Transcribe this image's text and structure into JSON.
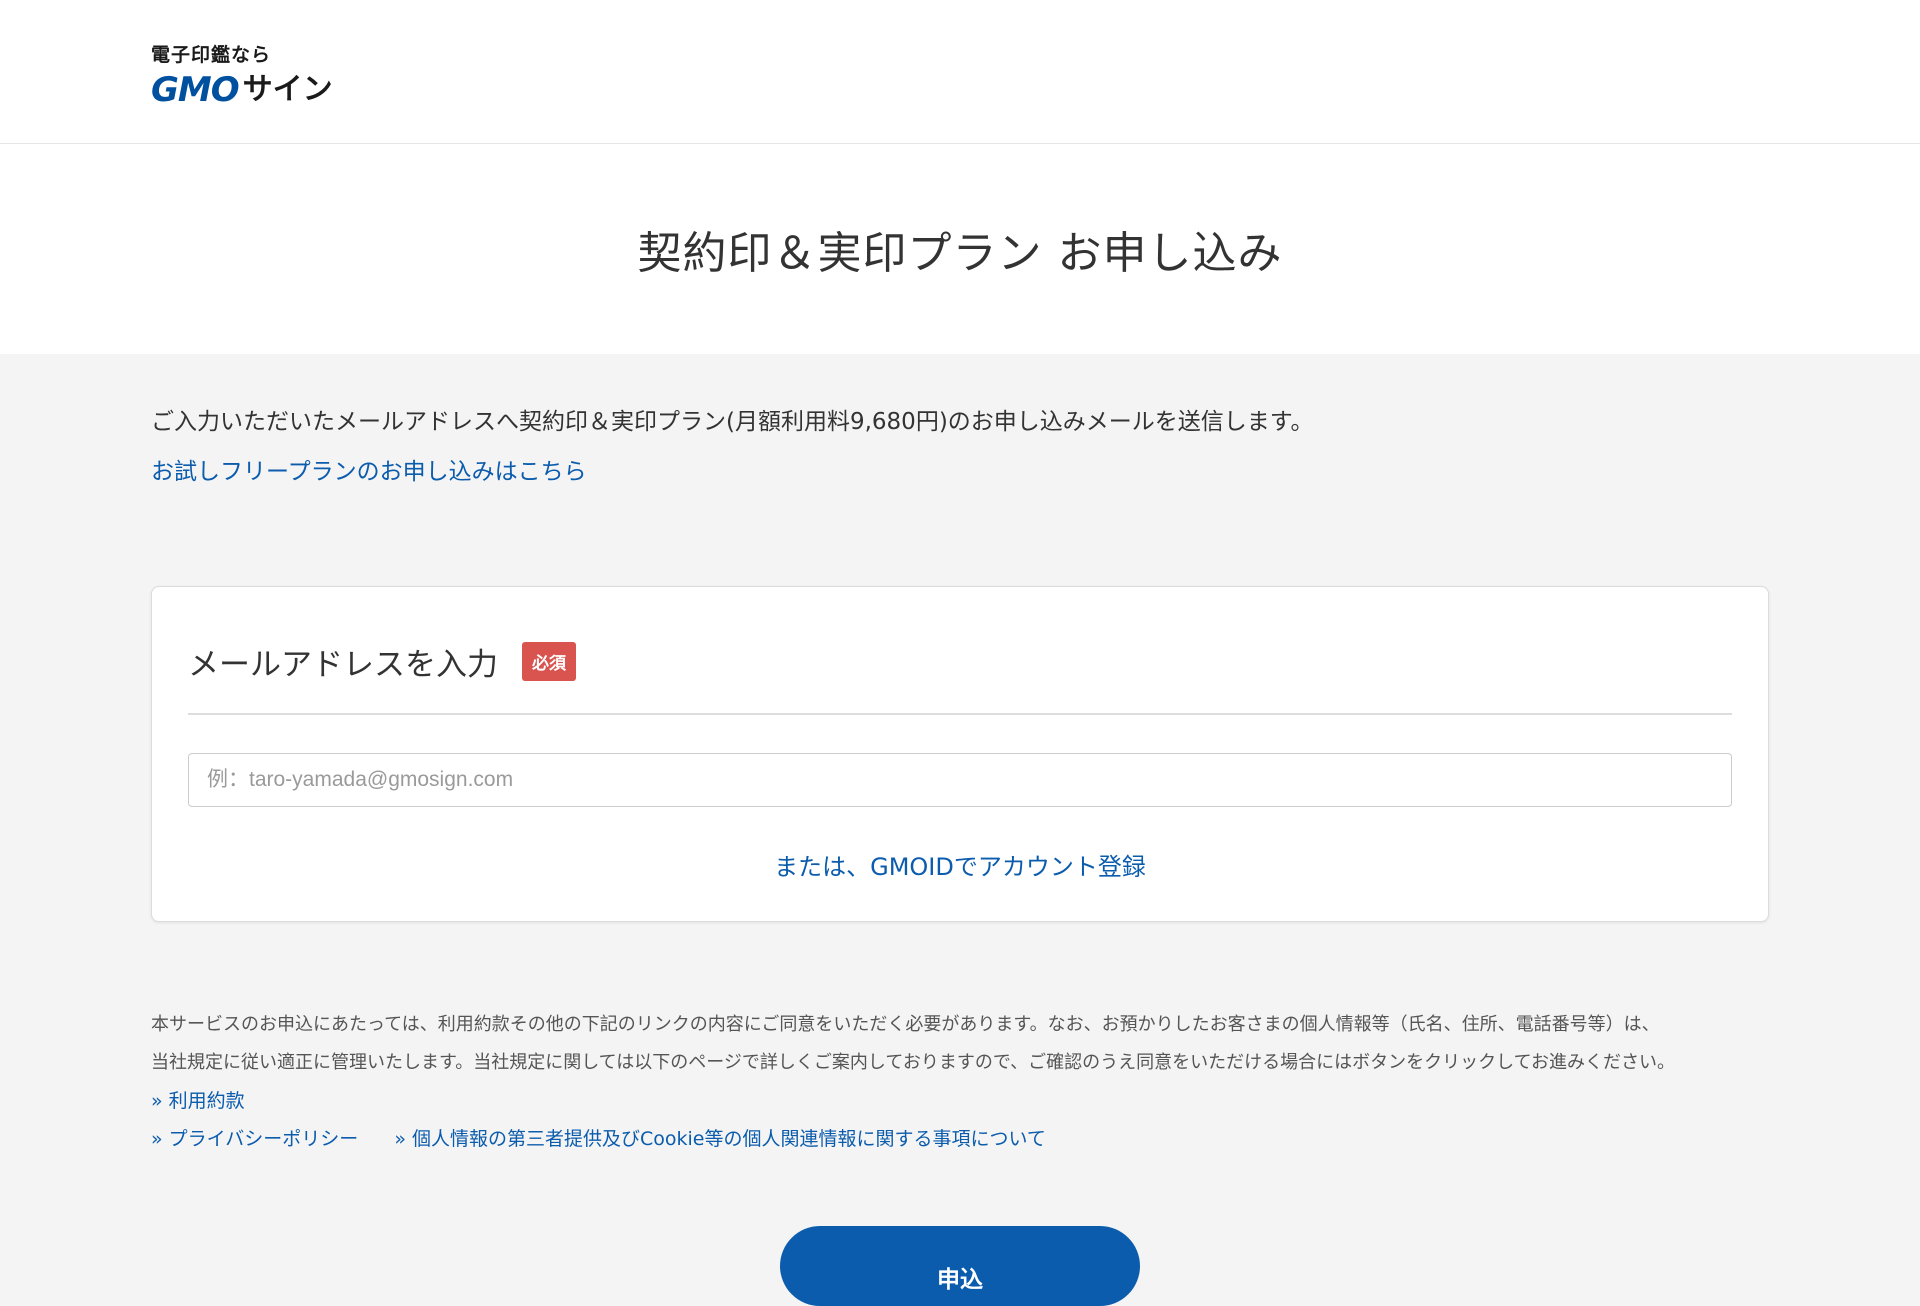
{
  "header": {
    "logo_tagline": "電子印鑑なら",
    "logo_gmo": "GMO",
    "logo_sign": "サイン"
  },
  "page": {
    "title": "契約印＆実印プラン お申し込み"
  },
  "intro": {
    "text": "ご入力いただいたメールアドレスへ契約印＆実印プラン(月額利用料9,680円)のお申し込みメールを送信します。",
    "trial_link": "お試しフリープランのお申し込みはこちら"
  },
  "email_card": {
    "label": "メールアドレスを入力",
    "required_badge": "必須",
    "placeholder": "例：taro-yamada@gmosign.com",
    "value": "",
    "gmoid_link": "または、GMOIDでアカウント登録"
  },
  "notice": {
    "line1": "本サービスのお申込にあたっては、利用約款その他の下記のリンクの内容にご同意をいただく必要があります。なお、お預かりしたお客さまの個人情報等（氏名、住所、電話番号等）は、",
    "line2": "当社規定に従い適正に管理いたします。当社規定に関しては以下のページで詳しくご案内しておりますので、ご確認のうえ同意をいただける場合にはボタンをクリックしてお進みください。"
  },
  "links": {
    "terms": "» 利用約款",
    "privacy": "» プライバシーポリシー",
    "third_party": "» 個人情報の第三者提供及びCookie等の個人関連情報に関する事項について"
  },
  "submit": {
    "label": "申込"
  },
  "colors": {
    "brand_blue": "#0b5cad",
    "required_red": "#d9534f",
    "background": "#f4f4f4"
  }
}
